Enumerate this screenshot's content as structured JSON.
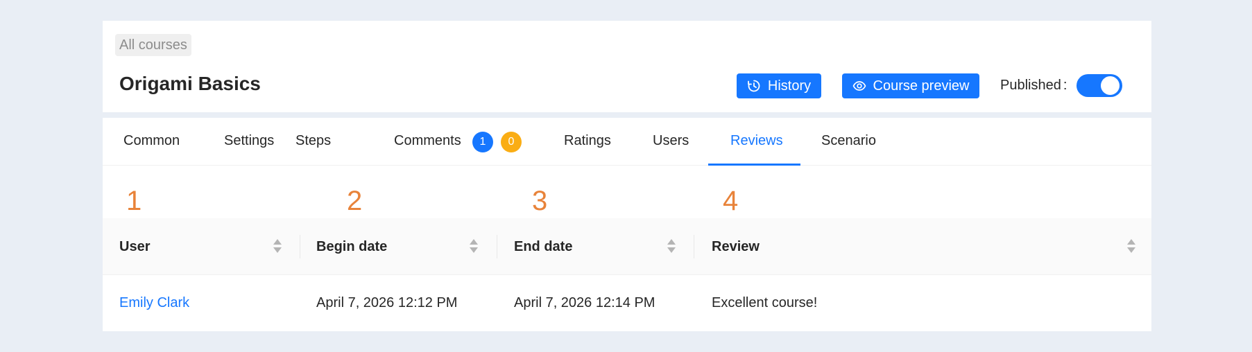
{
  "header": {
    "breadcrumb": "All courses",
    "title": "Origami Basics",
    "history_label": "History",
    "preview_label": "Course preview",
    "published_label": "Published",
    "published_colon": ":",
    "published": true
  },
  "tabs": [
    {
      "label": "Common"
    },
    {
      "label": "Settings"
    },
    {
      "label": "Steps"
    },
    {
      "label": "Comments",
      "badges": [
        "1",
        "0"
      ]
    },
    {
      "label": "Ratings"
    },
    {
      "label": "Users"
    },
    {
      "label": "Reviews",
      "active": true
    },
    {
      "label": "Scenario"
    }
  ],
  "column_numbers": [
    "1",
    "2",
    "3",
    "4"
  ],
  "table": {
    "columns": [
      "User",
      "Begin date",
      "End date",
      "Review"
    ],
    "rows": [
      {
        "user": "Emily Clark",
        "begin": "April 7, 2026 12:12 PM",
        "end": "April 7, 2026 12:14 PM",
        "review": "Excellent course!"
      }
    ]
  },
  "colors": {
    "accent": "#1677ff",
    "badge_warning": "#faad14",
    "annotation": "#e8833a"
  },
  "icons": [
    "history-icon",
    "eye-icon",
    "sort-icon"
  ]
}
